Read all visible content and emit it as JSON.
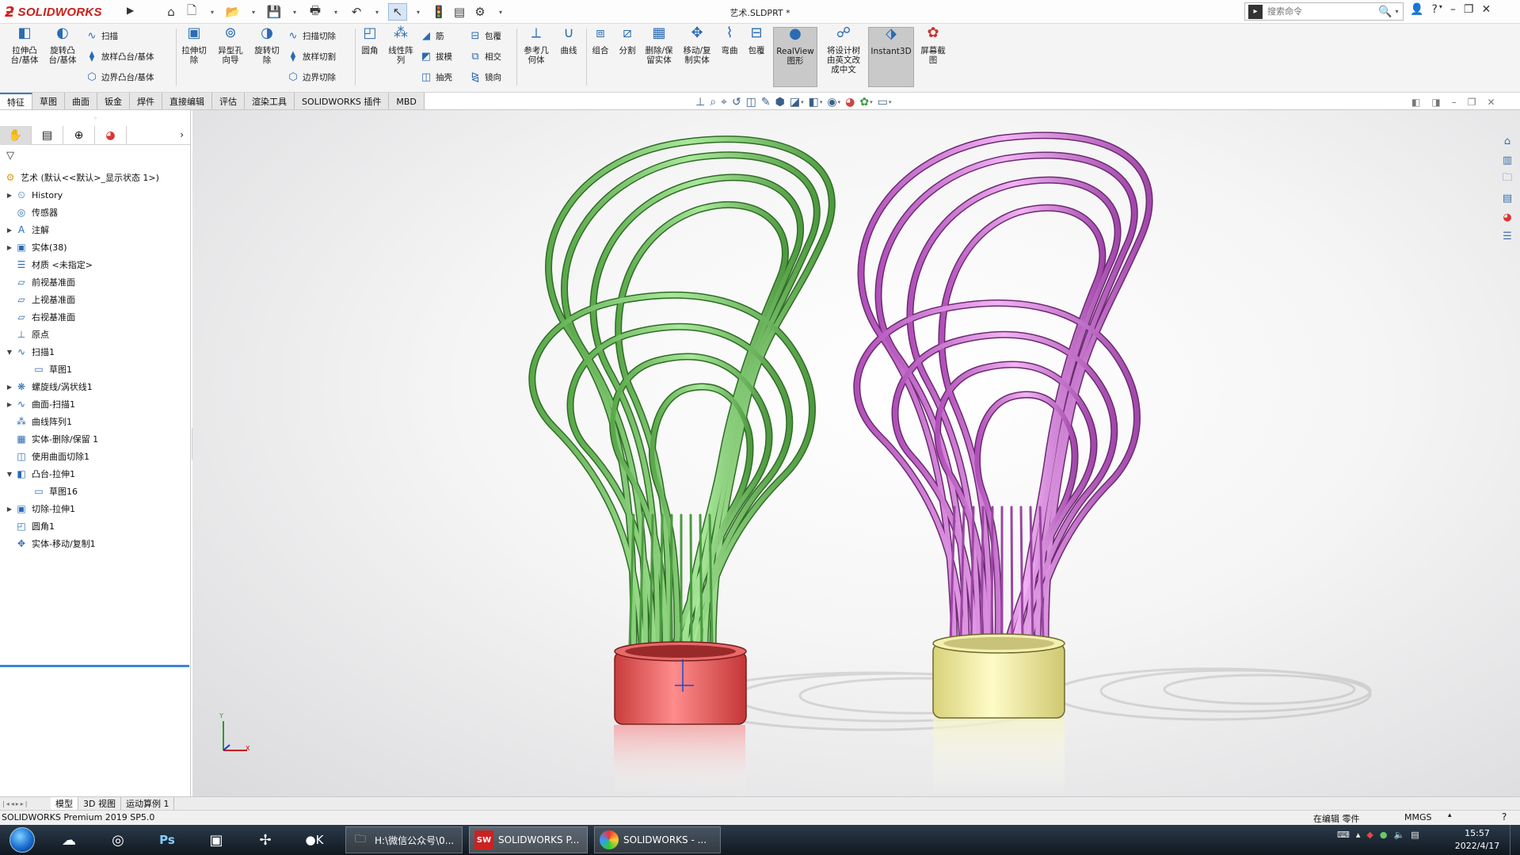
{
  "app": {
    "logo_text": "SOLIDWORKS",
    "document_title": "艺术.SLDPRT *"
  },
  "search": {
    "placeholder": "搜索命令"
  },
  "ribbon": {
    "extrude_boss": "拉伸凸\n台/基体",
    "revolve_boss": "旋转凸\n台/基体",
    "sweep": "扫描",
    "loft_boss": "放样凸台/基体",
    "boundary_boss": "边界凸台/基体",
    "extrude_cut": "拉伸切\n除",
    "hole_wizard": "异型孔\n向导",
    "revolve_cut": "旋转切\n除",
    "swept_cut": "扫描切除",
    "lofted_cut": "放样切割",
    "boundary_cut": "边界切除",
    "fillet": "圆角",
    "linear_pattern": "线性阵\n列",
    "rib": "筋",
    "draft": "拔模",
    "shell": "抽壳",
    "wrap": "包覆",
    "intersect": "相交",
    "mirror": "镜向",
    "ref_geometry": "参考几\n何体",
    "curves": "曲线",
    "combine": "组合",
    "split": "分割",
    "delete_keep": "删除/保\n留实体",
    "move_copy": "移动/复\n制实体",
    "flex": "弯曲",
    "wrap2": "包覆",
    "realview": "RealView\n图形",
    "translate_tree": "将设计树\n由英文改\n成中文",
    "instant3d": "Instant3D",
    "screen_capture": "屏幕截\n图"
  },
  "tabs": [
    "特征",
    "草图",
    "曲面",
    "钣金",
    "焊件",
    "直接编辑",
    "评估",
    "渲染工具",
    "SOLIDWORKS 插件",
    "MBD"
  ],
  "tree": {
    "root": "艺术 (默认<<默认>_显示状态 1>)",
    "items": [
      {
        "label": "History",
        "icon": "history-icon",
        "toggle": "▶",
        "level": 1
      },
      {
        "label": "传感器",
        "icon": "sensor-icon",
        "toggle": "",
        "level": 1
      },
      {
        "label": "注解",
        "icon": "annotation-icon",
        "toggle": "▶",
        "level": 1
      },
      {
        "label": "实体(38)",
        "icon": "solid-bodies-icon",
        "toggle": "▶",
        "level": 1
      },
      {
        "label": "材质 <未指定>",
        "icon": "material-icon",
        "toggle": "",
        "level": 1
      },
      {
        "label": "前视基准面",
        "icon": "plane-icon",
        "toggle": "",
        "level": 1
      },
      {
        "label": "上视基准面",
        "icon": "plane-icon",
        "toggle": "",
        "level": 1
      },
      {
        "label": "右视基准面",
        "icon": "plane-icon",
        "toggle": "",
        "level": 1
      },
      {
        "label": "原点",
        "icon": "origin-icon",
        "toggle": "",
        "level": 1
      },
      {
        "label": "扫描1",
        "icon": "sweep-icon",
        "toggle": "▼",
        "level": 1
      },
      {
        "label": "草图1",
        "icon": "sketch-icon",
        "toggle": "",
        "level": 2
      },
      {
        "label": "螺旋线/涡状线1",
        "icon": "helix-icon",
        "toggle": "▶",
        "level": 1
      },
      {
        "label": "曲面-扫描1",
        "icon": "surface-sweep-icon",
        "toggle": "▶",
        "level": 1
      },
      {
        "label": "曲线阵列1",
        "icon": "curve-pattern-icon",
        "toggle": "",
        "level": 1
      },
      {
        "label": "实体-删除/保留 1",
        "icon": "delete-body-icon",
        "toggle": "",
        "level": 1
      },
      {
        "label": "使用曲面切除1",
        "icon": "surface-cut-icon",
        "toggle": "",
        "level": 1
      },
      {
        "label": "凸台-拉伸1",
        "icon": "extrude-icon",
        "toggle": "▼",
        "level": 1
      },
      {
        "label": "草图16",
        "icon": "sketch-icon",
        "toggle": "",
        "level": 2
      },
      {
        "label": "切除-拉伸1",
        "icon": "cut-extrude-icon",
        "toggle": "▶",
        "level": 1
      },
      {
        "label": "圆角1",
        "icon": "fillet-icon",
        "toggle": "",
        "level": 1
      },
      {
        "label": "实体-移动/复制1",
        "icon": "move-copy-icon",
        "toggle": "",
        "level": 1
      }
    ]
  },
  "bottom_tabs": [
    "模型",
    "3D 视图",
    "运动算例 1"
  ],
  "status": {
    "product": "SOLIDWORKS Premium 2019 SP5.0",
    "editing": "在编辑 零件",
    "units": "MMGS"
  },
  "taskbar": {
    "win_explorer": "H:\\微信公众号\\0...",
    "win_sw_launch": "SOLIDWORKS P...",
    "win_sw": "SOLIDWORKS - ...",
    "time": "15:57",
    "date": "2022/4/17"
  },
  "colors": {
    "green_body": "#7ccf6d",
    "pink_body": "#d776dc",
    "red_base": "#e85a5a",
    "yellow_base": "#f1ee9c",
    "accent": "#3a86d4"
  }
}
